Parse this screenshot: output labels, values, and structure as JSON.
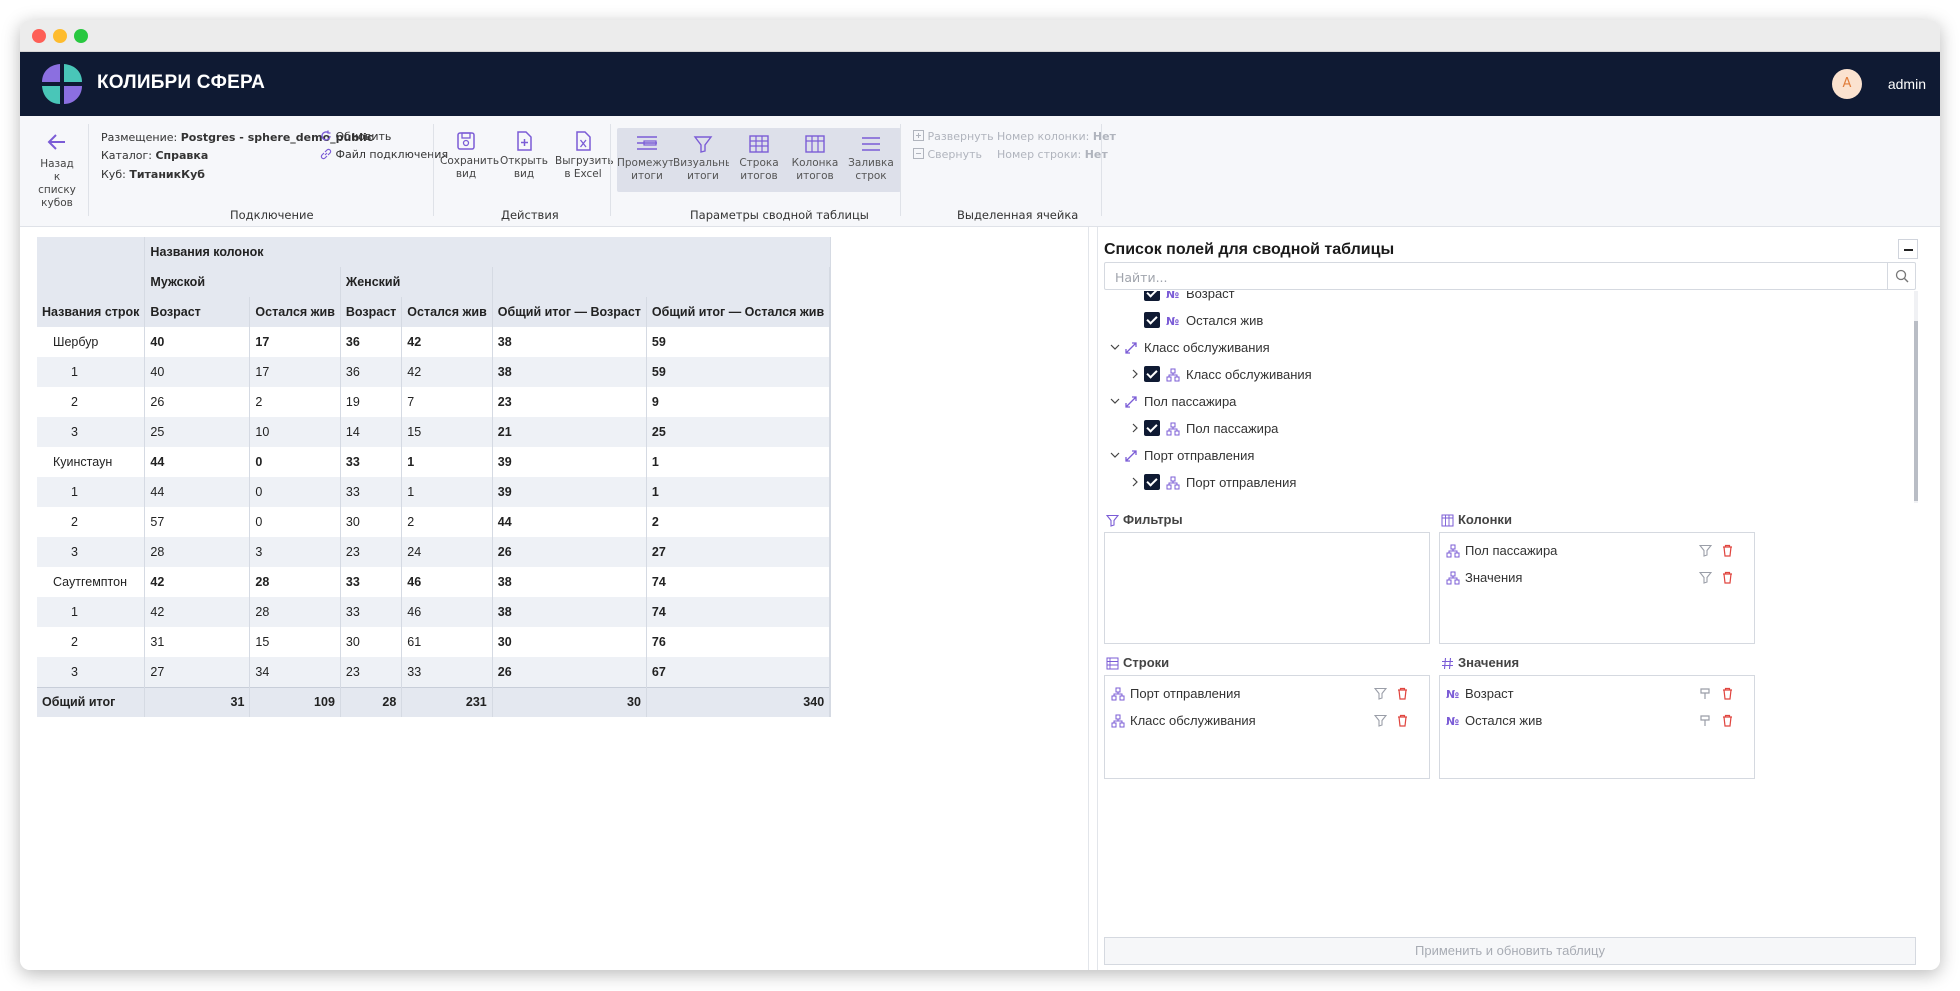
{
  "app": {
    "brand": "КОЛИБРИ СФЕРА",
    "user_initial": "A",
    "user_name": "admin",
    "accent_color": "#7b5cd6",
    "header_color": "#0f1a33"
  },
  "toolbar": {
    "back_label": "Назад к списку кубов",
    "placement_label": "Размещение:",
    "placement_value": "Postgres - sphere_demo_public",
    "catalog_label": "Каталог:",
    "catalog_value": "Справка",
    "cube_label": "Куб:",
    "cube_value": "ТитаникКуб",
    "refresh_label": "Обновить",
    "connfile_label": "Файл подключения",
    "group_connection": "Подключение",
    "save_label": "Сохранить вид",
    "open_label": "Открыть вид",
    "export_label": "Выгрузить в Excel",
    "group_actions": "Действия",
    "btn_subtotals": "Промежут. итоги",
    "btn_visual": "Визуальные итоги",
    "btn_rowtotals": "Строка итогов",
    "btn_coltotals": "Колонка итогов",
    "btn_fillrows": "Заливка строк",
    "group_pivot": "Параметры сводной таблицы",
    "expand_label": "Развернуть",
    "collapse_label": "Свернуть",
    "colnum_label": "Номер колонки:",
    "colnum_value": "Нет",
    "rownum_label": "Номер строки:",
    "rownum_value": "Нет",
    "group_cell": "Выделенная ячейка"
  },
  "pivot": {
    "col_names_header": "Названия колонок",
    "male": "Мужской",
    "female": "Женский",
    "row_names_header": "Названия строк",
    "age": "Возраст",
    "survived": "Остался жив",
    "total_age": "Общий итог — Возраст",
    "total_survived": "Общий итог — Остался жив",
    "rows": [
      {
        "label": "Шербур",
        "bold": true,
        "v": [
          "40",
          "17",
          "36",
          "42",
          "38",
          "59"
        ]
      },
      {
        "label": "1",
        "bold": false,
        "v": [
          "40",
          "17",
          "36",
          "42",
          "38",
          "59"
        ]
      },
      {
        "label": "2",
        "bold": false,
        "v": [
          "26",
          "2",
          "19",
          "7",
          "23",
          "9"
        ]
      },
      {
        "label": "3",
        "bold": false,
        "v": [
          "25",
          "10",
          "14",
          "15",
          "21",
          "25"
        ]
      },
      {
        "label": "Куинстаун",
        "bold": true,
        "v": [
          "44",
          "0",
          "33",
          "1",
          "39",
          "1"
        ]
      },
      {
        "label": "1",
        "bold": false,
        "v": [
          "44",
          "0",
          "33",
          "1",
          "39",
          "1"
        ]
      },
      {
        "label": "2",
        "bold": false,
        "v": [
          "57",
          "0",
          "30",
          "2",
          "44",
          "2"
        ]
      },
      {
        "label": "3",
        "bold": false,
        "v": [
          "28",
          "3",
          "23",
          "24",
          "26",
          "27"
        ]
      },
      {
        "label": "Саутгемптон",
        "bold": true,
        "v": [
          "42",
          "28",
          "33",
          "46",
          "38",
          "74"
        ]
      },
      {
        "label": "1",
        "bold": false,
        "v": [
          "42",
          "28",
          "33",
          "46",
          "38",
          "74"
        ]
      },
      {
        "label": "2",
        "bold": false,
        "v": [
          "31",
          "15",
          "30",
          "61",
          "30",
          "76"
        ]
      },
      {
        "label": "3",
        "bold": false,
        "v": [
          "27",
          "34",
          "23",
          "33",
          "26",
          "67"
        ]
      }
    ],
    "grand_total_label": "Общий итог",
    "grand_total": [
      "31",
      "109",
      "28",
      "231",
      "30",
      "340"
    ]
  },
  "fields": {
    "title": "Список полей для сводной таблицы",
    "search_placeholder": "Найти...",
    "tree": [
      {
        "kind": "measure",
        "label": "Возраст"
      },
      {
        "kind": "measure",
        "label": "Остался жив"
      },
      {
        "kind": "dimension",
        "label": "Класс обслуживания"
      },
      {
        "kind": "hierarchy",
        "label": "Класс обслуживания"
      },
      {
        "kind": "dimension",
        "label": "Пол пассажира"
      },
      {
        "kind": "hierarchy",
        "label": "Пол пассажира"
      },
      {
        "kind": "dimension",
        "label": "Порт отправления"
      },
      {
        "kind": "hierarchy",
        "label": "Порт отправления"
      }
    ],
    "filters_title": "Фильтры",
    "columns_title": "Колонки",
    "columns": [
      "Пол пассажира",
      "Значения"
    ],
    "rows_title": "Строки",
    "rows": [
      "Порт отправления",
      "Класс обслуживания"
    ],
    "values_title": "Значения",
    "values": [
      "Возраст",
      "Остался жив"
    ],
    "apply_label": "Применить и обновить таблицу"
  }
}
